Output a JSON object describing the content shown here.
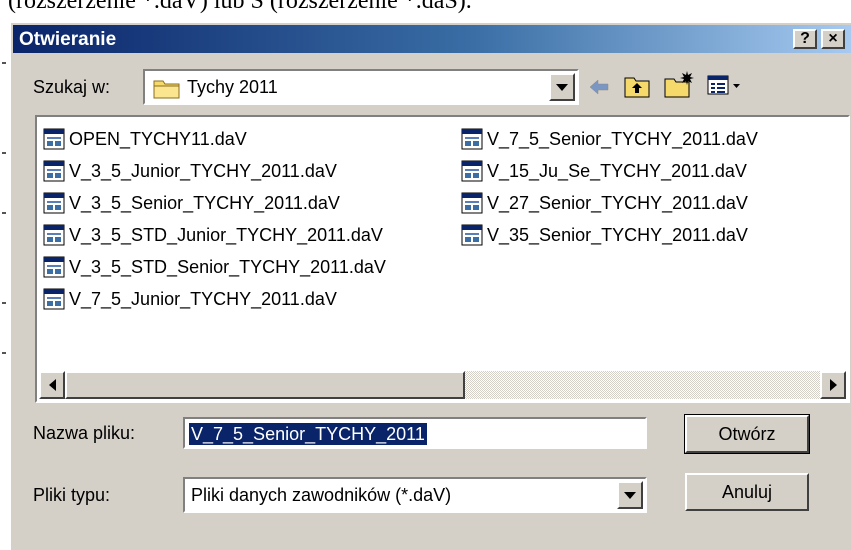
{
  "background_text": "(rozszerzenie *.daV) lub S (rozszerzenie *.daS).",
  "window": {
    "title": "Otwieranie",
    "help_button": "?",
    "close_button": "×"
  },
  "look_in": {
    "label": "Szukaj w:",
    "value": "Tychy 2011"
  },
  "toolbar": {
    "icons": [
      "back-arrow-icon",
      "up-folder-icon",
      "new-folder-icon",
      "view-menu-icon"
    ]
  },
  "files": {
    "column1": [
      "OPEN_TYCHY11.daV",
      "V_3_5_Junior_TYCHY_2011.daV",
      "V_3_5_Senior_TYCHY_2011.daV",
      "V_3_5_STD_Junior_TYCHY_2011.daV",
      "V_3_5_STD_Senior_TYCHY_2011.daV",
      "V_7_5_Junior_TYCHY_2011.daV"
    ],
    "column2": [
      "V_7_5_Senior_TYCHY_2011.daV",
      "V_15_Ju_Se_TYCHY_2011.daV",
      "V_27_Senior_TYCHY_2011.daV",
      "V_35_Senior_TYCHY_2011.daV"
    ]
  },
  "file_name": {
    "label": "Nazwa pliku:",
    "value": "V_7_5_Senior_TYCHY_2011"
  },
  "file_type": {
    "label": "Pliki typu:",
    "value": "Pliki danych zawodników (*.daV)"
  },
  "buttons": {
    "open": "Otwórz",
    "cancel": "Anuluj"
  },
  "colors": {
    "title_bar_start": "#0a246a",
    "title_bar_end": "#a6caf0",
    "dialog_face": "#d4d0c8",
    "selection": "#0a246a"
  }
}
